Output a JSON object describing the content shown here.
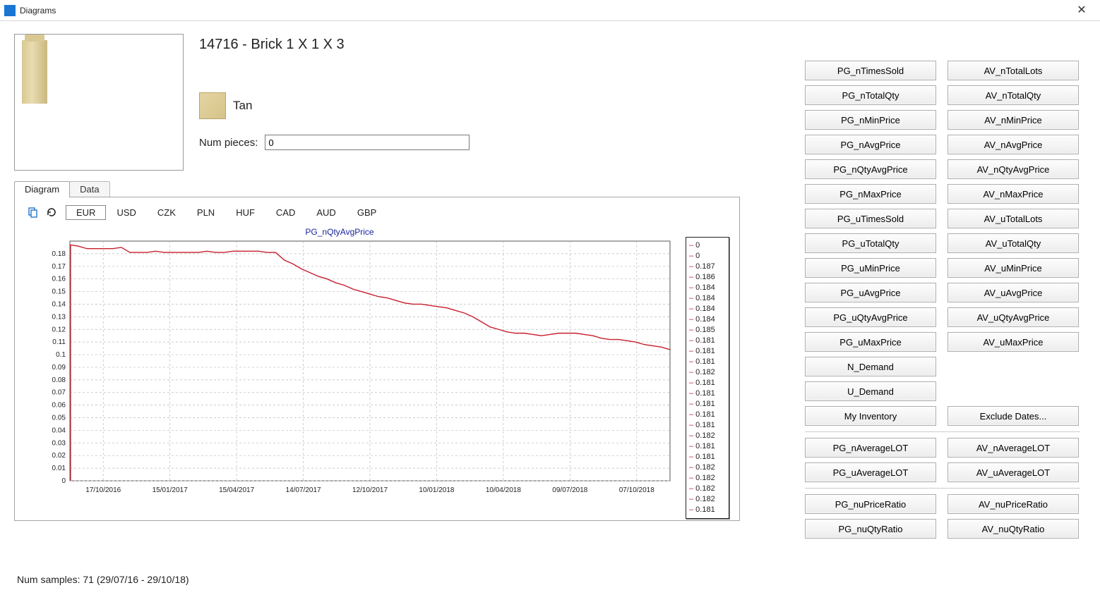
{
  "window": {
    "title": "Diagrams"
  },
  "part": {
    "title": "14716 - Brick 1 X 1 X 3",
    "color_name": "Tan",
    "num_pieces_label": "Num pieces:",
    "num_pieces_value": "0"
  },
  "tabs": [
    {
      "label": "Diagram",
      "active": true
    },
    {
      "label": "Data",
      "active": false
    }
  ],
  "currencies": [
    "EUR",
    "USD",
    "CZK",
    "PLN",
    "HUF",
    "CAD",
    "AUD",
    "GBP"
  ],
  "active_currency": "EUR",
  "chart_data": {
    "type": "line",
    "title": "PG_nQtyAvgPrice",
    "xlabel": "",
    "ylabel": "",
    "ylim": [
      0,
      0.19
    ],
    "y_ticks": [
      0,
      0.01,
      0.02,
      0.03,
      0.04,
      0.05,
      0.06,
      0.07,
      0.08,
      0.09,
      0.1,
      0.11,
      0.12,
      0.13,
      0.14,
      0.15,
      0.16,
      0.17,
      0.18
    ],
    "x_tick_labels": [
      "17/10/2016",
      "15/01/2017",
      "15/04/2017",
      "14/07/2017",
      "12/10/2017",
      "10/01/2018",
      "10/04/2018",
      "09/07/2018",
      "07/10/2018"
    ],
    "series": [
      {
        "name": "PG_nQtyAvgPrice",
        "color": "#c81e2b",
        "values": [
          0.187,
          0.186,
          0.184,
          0.184,
          0.184,
          0.184,
          0.185,
          0.181,
          0.181,
          0.181,
          0.182,
          0.181,
          0.181,
          0.181,
          0.181,
          0.181,
          0.182,
          0.181,
          0.181,
          0.182,
          0.182,
          0.182,
          0.182,
          0.181,
          0.181,
          0.175,
          0.172,
          0.168,
          0.165,
          0.162,
          0.16,
          0.157,
          0.155,
          0.152,
          0.15,
          0.148,
          0.146,
          0.145,
          0.143,
          0.141,
          0.14,
          0.14,
          0.139,
          0.138,
          0.137,
          0.135,
          0.133,
          0.13,
          0.126,
          0.122,
          0.12,
          0.118,
          0.117,
          0.117,
          0.116,
          0.115,
          0.116,
          0.117,
          0.117,
          0.117,
          0.116,
          0.115,
          0.113,
          0.112,
          0.112,
          0.111,
          0.11,
          0.108,
          0.107,
          0.106,
          0.104
        ]
      }
    ]
  },
  "legend_values": [
    "0",
    "0",
    "0.187",
    "0.186",
    "0.184",
    "0.184",
    "0.184",
    "0.184",
    "0.185",
    "0.181",
    "0.181",
    "0.181",
    "0.182",
    "0.181",
    "0.181",
    "0.181",
    "0.181",
    "0.181",
    "0.182",
    "0.181",
    "0.181",
    "0.182",
    "0.182",
    "0.182",
    "0.182",
    "0.181"
  ],
  "buttons_left": [
    "PG_nTimesSold",
    "PG_nTotalQty",
    "PG_nMinPrice",
    "PG_nAvgPrice",
    "PG_nQtyAvgPrice",
    "PG_nMaxPrice",
    "PG_uTimesSold",
    "PG_uTotalQty",
    "PG_uMinPrice",
    "PG_uAvgPrice",
    "PG_uQtyAvgPrice",
    "PG_uMaxPrice",
    "N_Demand",
    "U_Demand",
    "My Inventory"
  ],
  "buttons_right": [
    "AV_nTotalLots",
    "AV_nTotalQty",
    "AV_nMinPrice",
    "AV_nAvgPrice",
    "AV_nQtyAvgPrice",
    "AV_nMaxPrice",
    "AV_uTotalLots",
    "AV_uTotalQty",
    "AV_uMinPrice",
    "AV_uAvgPrice",
    "AV_uQtyAvgPrice",
    "AV_uMaxPrice",
    "",
    "",
    "Exclude Dates..."
  ],
  "group2_left": [
    "PG_nAverageLOT",
    "PG_uAverageLOT"
  ],
  "group2_right": [
    "AV_nAverageLOT",
    "AV_uAverageLOT"
  ],
  "group3_left": [
    "PG_nuPriceRatio",
    "PG_nuQtyRatio"
  ],
  "group3_right": [
    "AV_nuPriceRatio",
    "AV_nuQtyRatio"
  ],
  "status": "Num samples: 71 (29/07/16 - 29/10/18)"
}
